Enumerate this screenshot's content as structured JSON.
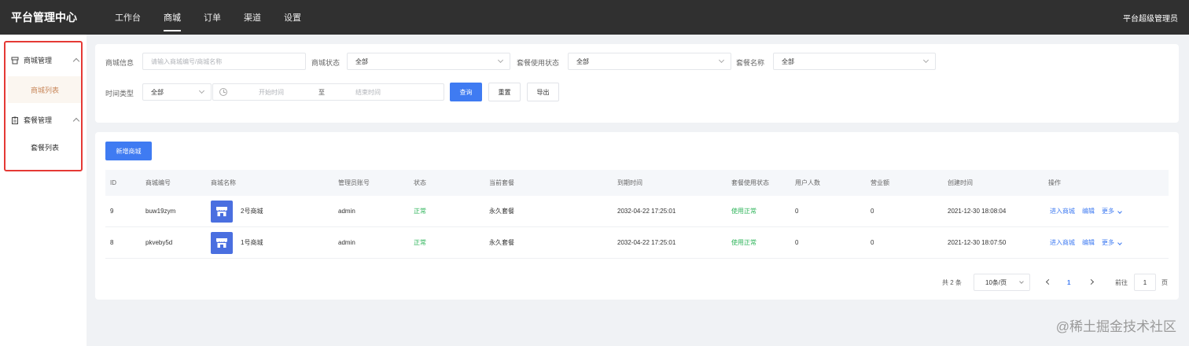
{
  "header": {
    "brand": "平台管理中心",
    "nav": [
      "工作台",
      "商城",
      "订单",
      "渠道",
      "设置"
    ],
    "active_nav": "商城",
    "user": "平台超级管理员"
  },
  "sidebar": {
    "groups": [
      {
        "label": "商城管理",
        "icon": "shop-icon",
        "items": [
          "商城列表"
        ]
      },
      {
        "label": "套餐管理",
        "icon": "clipboard-icon",
        "items": [
          "套餐列表"
        ]
      }
    ],
    "active_item": "商城列表"
  },
  "filters": {
    "shop_info_label": "商城信息",
    "shop_info_placeholder": "请输入商城编号/商城名称",
    "shop_status_label": "商城状态",
    "shop_status_value": "全部",
    "package_status_label": "套餐使用状态",
    "package_status_value": "全部",
    "package_name_label": "套餐名称",
    "package_name_value": "全部",
    "time_type_label": "时间类型",
    "time_type_value": "全部",
    "start_placeholder": "开始时间",
    "range_sep": "至",
    "end_placeholder": "结束时间",
    "search_btn": "查询",
    "reset_btn": "重置",
    "export_btn": "导出"
  },
  "add_button": "新增商城",
  "table": {
    "columns": [
      "ID",
      "商城编号",
      "商城名称",
      "管理员账号",
      "状态",
      "当前套餐",
      "到期时间",
      "套餐使用状态",
      "用户人数",
      "营业额",
      "创建时间",
      "操作"
    ],
    "rows": [
      {
        "id": "9",
        "code": "buw19zym",
        "name": "2号商城",
        "admin": "admin",
        "status": "正常",
        "package": "永久套餐",
        "expire": "2032-04-22 17:25:01",
        "package_status": "使用正常",
        "users": "0",
        "revenue": "0",
        "created": "2021-12-30 18:08:04"
      },
      {
        "id": "8",
        "code": "pkveby5d",
        "name": "1号商城",
        "admin": "admin",
        "status": "正常",
        "package": "永久套餐",
        "expire": "2032-04-22 17:25:01",
        "package_status": "使用正常",
        "users": "0",
        "revenue": "0",
        "created": "2021-12-30 18:07:50"
      }
    ],
    "actions": {
      "enter": "进入商城",
      "edit": "编辑",
      "more": "更多"
    }
  },
  "pagination": {
    "total": "共 2 条",
    "page_size": "10条/页",
    "current_page": "1",
    "goto_label": "前往",
    "goto_value": "1",
    "page_unit": "页"
  },
  "watermark": "@稀土掘金技术社区",
  "colors": {
    "topbar": "#303030",
    "primary": "#3f7bf2",
    "success": "#2fb45b",
    "active_menu": "#c8875a",
    "highlight": "#e53935"
  }
}
